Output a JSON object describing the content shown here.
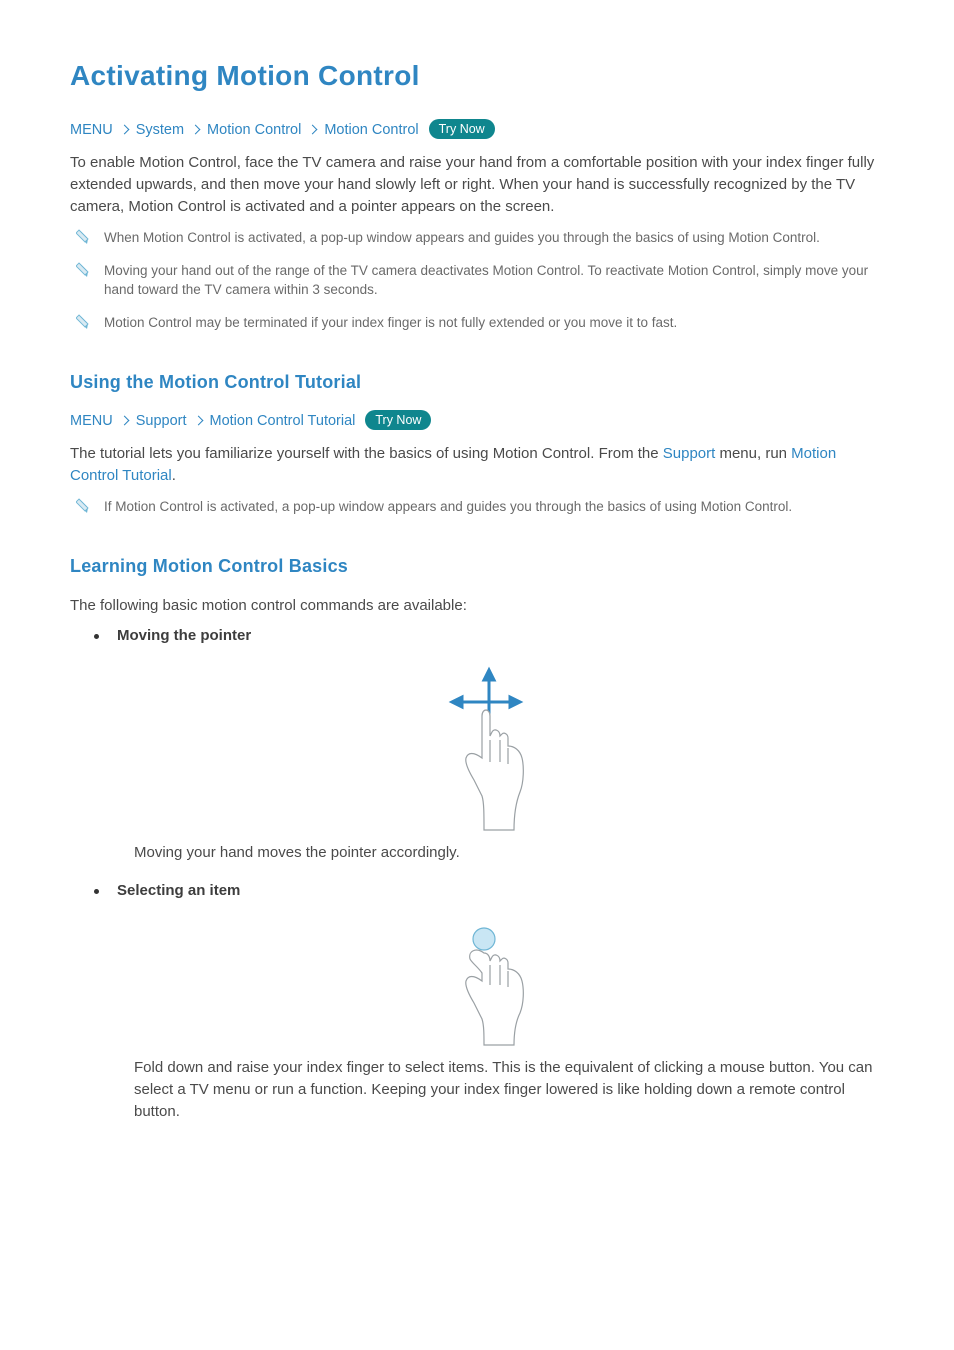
{
  "title": "Activating Motion Control",
  "section1": {
    "crumbs": [
      "MENU",
      "System",
      "Motion Control",
      "Motion Control"
    ],
    "tryNow": "Try Now",
    "intro": "To enable Motion Control, face the TV camera and raise your hand from a comfortable position with your index finger fully extended upwards, and then move your hand slowly left or right. When your hand is successfully recognized by the TV camera, Motion Control is activated and a pointer appears on the screen.",
    "notes": [
      "When Motion Control is activated, a pop-up window appears and guides you through the basics of using Motion Control.",
      "Moving your hand out of the range of the TV camera deactivates Motion Control. To reactivate Motion Control, simply move your hand toward the TV camera within 3 seconds.",
      "Motion Control may be terminated if your index finger is not fully extended or you move it to fast."
    ]
  },
  "section2": {
    "heading": "Using the Motion Control Tutorial",
    "crumbs": [
      "MENU",
      "Support",
      "Motion Control Tutorial"
    ],
    "tryNow": "Try Now",
    "body_pre": "The tutorial lets you familiarize yourself with the basics of using Motion Control. From the ",
    "body_link1": "Support",
    "body_mid": " menu, run ",
    "body_link2": "Motion Control Tutorial",
    "body_post": ".",
    "notes": [
      "If Motion Control is activated, a pop-up window appears and guides you through the basics of using Motion Control."
    ]
  },
  "section3": {
    "heading": "Learning Motion Control Basics",
    "intro": "The following basic motion control commands are available:",
    "items": [
      {
        "label": "Moving the pointer",
        "caption": "Moving your hand moves the pointer accordingly."
      },
      {
        "label": "Selecting an item",
        "caption": "Fold down and raise your index finger to select items. This is the equivalent of clicking a mouse button. You can select a TV menu or run a function. Keeping your index finger lowered is like holding down a remote control button."
      }
    ]
  }
}
